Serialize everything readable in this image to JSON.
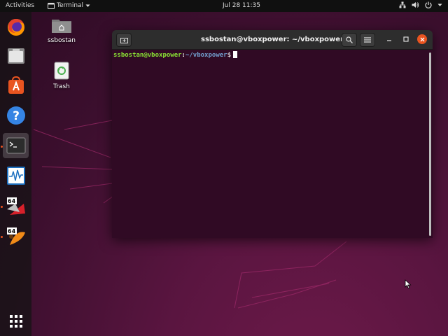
{
  "topbar": {
    "activities": "Activities",
    "app_name": "Terminal",
    "clock": "Jul 28  11:35"
  },
  "dock": {
    "apps": [
      {
        "name": "Firefox",
        "icon": "firefox-icon"
      },
      {
        "name": "Files",
        "icon": "files-icon"
      },
      {
        "name": "Ubuntu Software",
        "icon": "software-icon"
      },
      {
        "name": "Help",
        "icon": "help-icon"
      },
      {
        "name": "Terminal",
        "icon": "terminal-icon"
      },
      {
        "name": "System Monitor",
        "icon": "system-monitor-icon"
      },
      {
        "name": "64-bit App",
        "icon": "app64-red-icon"
      },
      {
        "name": "64-bit App 2",
        "icon": "app64-orange-icon"
      },
      {
        "name": "Show Applications",
        "icon": "app-grid-icon"
      }
    ]
  },
  "desktop": {
    "home_label": "ssbostan",
    "trash_label": "Trash"
  },
  "terminal": {
    "title": "ssbostan@vboxpower: ~/vboxpower",
    "prompt_user": "ssbostan@vboxpower",
    "prompt_colon": ":",
    "prompt_path": "~/vboxpower",
    "prompt_symbol": "$"
  },
  "colors": {
    "ubuntu_orange": "#e95420",
    "terminal_bg": "#300a24",
    "prompt_user": "#8ae234",
    "prompt_path": "#729fcf"
  }
}
